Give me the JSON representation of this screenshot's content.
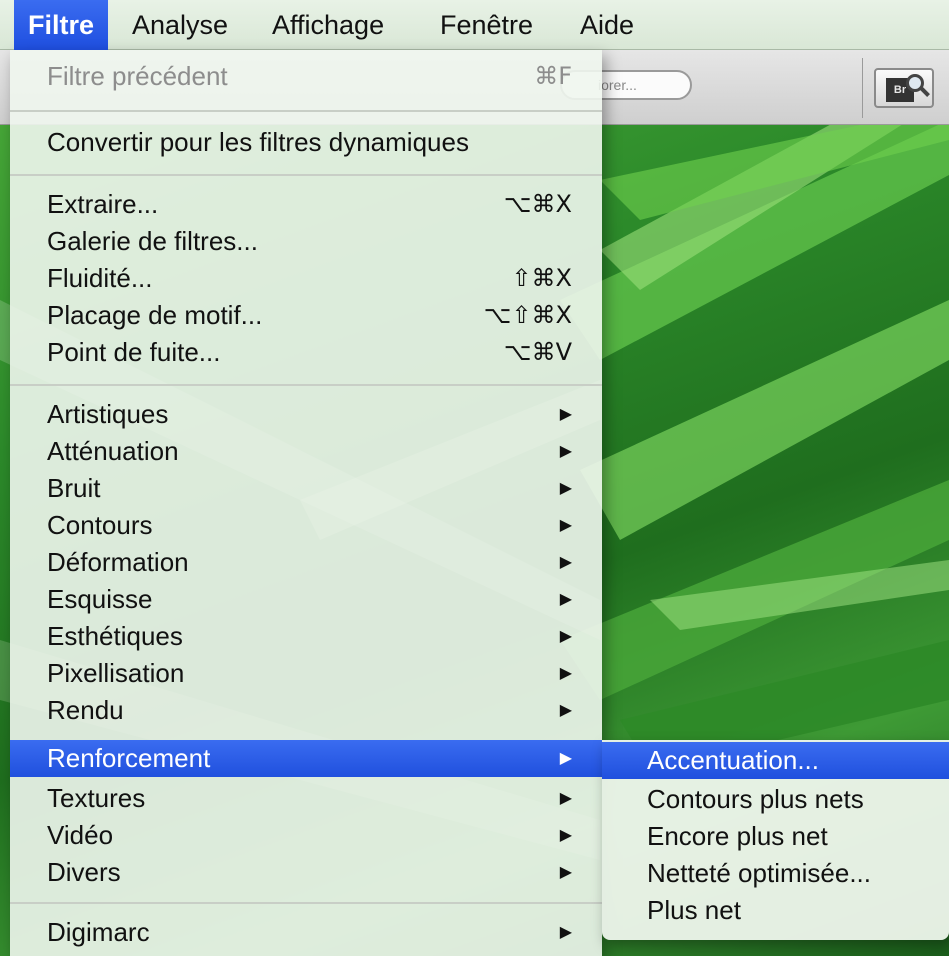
{
  "menubar": {
    "items": [
      {
        "label": "Filtre",
        "active": true
      },
      {
        "label": "Analyse"
      },
      {
        "label": "Affichage"
      },
      {
        "label": "Fenêtre"
      },
      {
        "label": "Aide"
      }
    ]
  },
  "toolbar": {
    "search_text": "iorer...",
    "bridge_badge": "Br"
  },
  "filter_menu": {
    "items": [
      {
        "label": "Filtre précédent",
        "shortcut": "⌘F",
        "disabled": true
      },
      {
        "label": "Convertir pour les filtres dynamiques"
      },
      {
        "label": "Extraire...",
        "shortcut": "⌥⌘X"
      },
      {
        "label": "Galerie de filtres..."
      },
      {
        "label": "Fluidité...",
        "shortcut": "⇧⌘X"
      },
      {
        "label": "Placage de motif...",
        "shortcut": "⌥⇧⌘X"
      },
      {
        "label": "Point de fuite...",
        "shortcut": "⌥⌘V"
      },
      {
        "label": "Artistiques",
        "submenu": true
      },
      {
        "label": "Atténuation",
        "submenu": true
      },
      {
        "label": "Bruit",
        "submenu": true
      },
      {
        "label": "Contours",
        "submenu": true
      },
      {
        "label": "Déformation",
        "submenu": true
      },
      {
        "label": "Esquisse",
        "submenu": true
      },
      {
        "label": "Esthétiques",
        "submenu": true
      },
      {
        "label": "Pixellisation",
        "submenu": true
      },
      {
        "label": "Rendu",
        "submenu": true
      },
      {
        "label": "Renforcement",
        "submenu": true,
        "highlighted": true
      },
      {
        "label": "Textures",
        "submenu": true
      },
      {
        "label": "Vidéo",
        "submenu": true
      },
      {
        "label": "Divers",
        "submenu": true
      },
      {
        "label": "Digimarc",
        "submenu": true
      }
    ],
    "submenu_arrow": "▶"
  },
  "renforcement_submenu": {
    "items": [
      {
        "label": "Accentuation...",
        "highlighted": true
      },
      {
        "label": "Contours plus nets"
      },
      {
        "label": "Encore plus net"
      },
      {
        "label": "Netteté optimisée..."
      },
      {
        "label": "Plus net"
      }
    ]
  },
  "colors": {
    "highlight": "#2050de",
    "menu_background": "#f0f6ee",
    "wallpaper": "#2f8d2c"
  }
}
